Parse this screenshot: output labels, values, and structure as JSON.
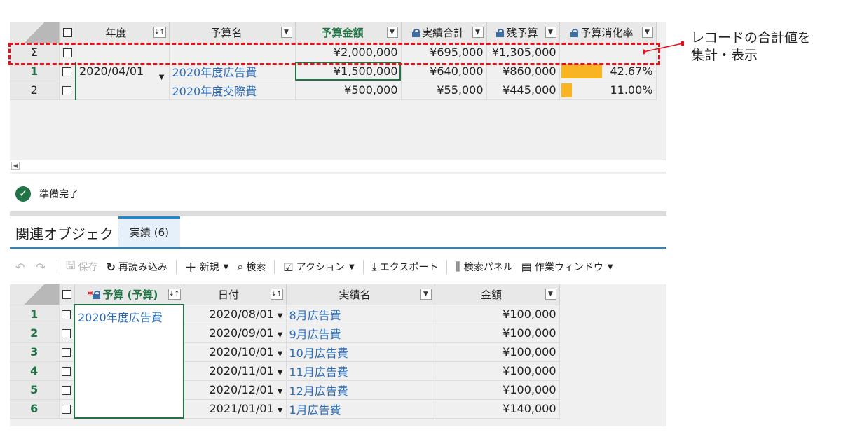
{
  "top_grid": {
    "headers": {
      "year": "年度",
      "budget_name": "予算名",
      "budget_amount": "予算金額",
      "actual_total": "実績合計",
      "remaining": "残予算",
      "consumption": "予算消化率"
    },
    "sum_row": {
      "symbol": "Σ",
      "budget_amount": "¥2,000,000",
      "actual_total": "¥695,000",
      "remaining": "¥1,305,000"
    },
    "rows": [
      {
        "num": "1",
        "year": "2020/04/01",
        "name": "2020年度広告費",
        "amount": "¥1,500,000",
        "actual": "¥640,000",
        "remaining": "¥860,000",
        "rate": "42.67%",
        "rate_value": 42.67
      },
      {
        "num": "2",
        "year": "",
        "name": "2020年度交際費",
        "amount": "¥500,000",
        "actual": "¥55,000",
        "remaining": "¥445,000",
        "rate": "11.00%",
        "rate_value": 11.0
      }
    ]
  },
  "callout": {
    "line1": "レコードの合計値を",
    "line2": "集計・表示"
  },
  "status": {
    "text": "準備完了"
  },
  "related": {
    "title": "関連オブジェクト",
    "tab_label": "実績 (6)"
  },
  "toolbar": {
    "save": "保存",
    "reload": "再読み込み",
    "new": "新規",
    "search": "検索",
    "action": "アクション",
    "export": "エクスポート",
    "search_panel": "検索パネル",
    "work_window": "作業ウィンドウ"
  },
  "bottom_grid": {
    "headers": {
      "budget": "予算 (予算)",
      "date": "日付",
      "actual_name": "実績名",
      "amount": "金額"
    },
    "rows": [
      {
        "num": "1",
        "budget": "2020年度広告費",
        "date": "2020/08/01",
        "name": "8月広告費",
        "amount": "¥100,000"
      },
      {
        "num": "2",
        "budget": "",
        "date": "2020/09/01",
        "name": "9月広告費",
        "amount": "¥100,000"
      },
      {
        "num": "3",
        "budget": "",
        "date": "2020/10/01",
        "name": "10月広告費",
        "amount": "¥100,000"
      },
      {
        "num": "4",
        "budget": "",
        "date": "2020/11/01",
        "name": "11月広告費",
        "amount": "¥100,000"
      },
      {
        "num": "5",
        "budget": "",
        "date": "2020/12/01",
        "name": "12月広告費",
        "amount": "¥100,000"
      },
      {
        "num": "6",
        "budget": "",
        "date": "2021/01/01",
        "name": "1月広告費",
        "amount": "¥140,000"
      }
    ]
  },
  "colors": {
    "accent": "#217346",
    "link": "#2b6cb8",
    "highlight": "#e3111c",
    "bar": "#f8b422",
    "tab": "#1e88d0"
  }
}
